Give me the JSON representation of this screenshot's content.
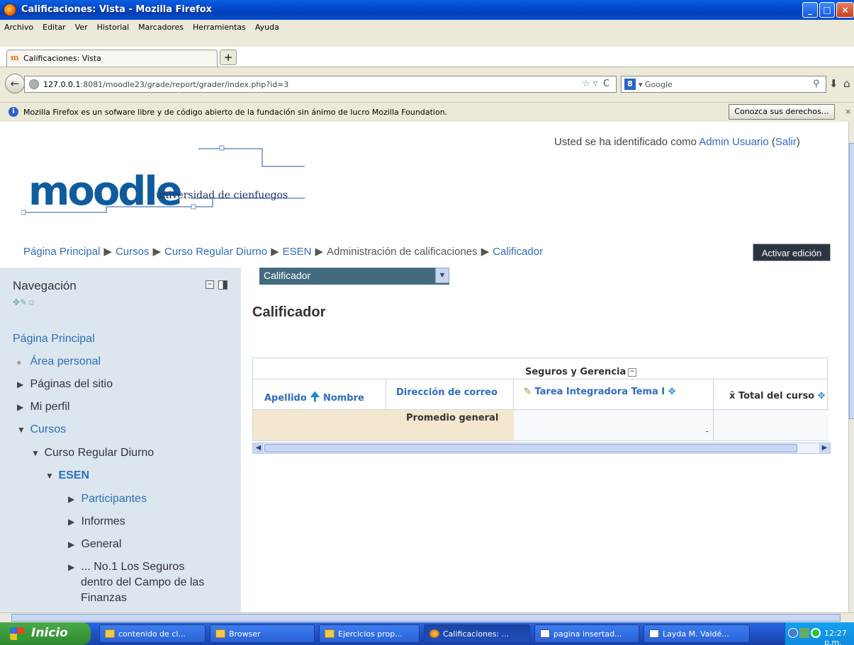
{
  "window": {
    "title": "Calificaciones: Vista - Mozilla Firefox"
  },
  "menu": [
    "Archivo",
    "Editar",
    "Ver",
    "Historial",
    "Marcadores",
    "Herramientas",
    "Ayuda"
  ],
  "tab": {
    "icon_text": "m",
    "label": "Calificaciones: Vista",
    "new_tab": "+"
  },
  "nav": {
    "url_host": "127.0.0.1",
    "url_rest": ":8081/moodle23/grade/report/grader/index.php?id=3",
    "search_placeholder": "Google",
    "search_engine_letter": "8"
  },
  "notification": {
    "text": "Mozilla Firefox es un sofware libre y de código abierto de la fundación sin ánimo de lucro Mozilla Foundation.",
    "button": "Conozca sus derechos…",
    "close": "×"
  },
  "page": {
    "login_prefix": "Usted se ha identificado como ",
    "login_user": "Admin Usuario",
    "logout": "Salir",
    "logo_word": "moodle",
    "logo_sub": "universidad de cienfuegos",
    "breadcrumb": [
      "Página Principal",
      "Cursos",
      "Curso Regular Diurno",
      "ESEN",
      "Administración de calificaciones",
      "Calificador"
    ],
    "edit_button": "Activar edición",
    "select_value": "Calificador",
    "main_title": "Calificador"
  },
  "sidebar": {
    "heading": "Navegación",
    "items": {
      "home": "Página Principal",
      "personal": "Área personal",
      "site_pages": "Páginas del sitio",
      "profile": "Mi perfil",
      "courses": "Cursos",
      "course": "Curso Regular Diurno",
      "esen": "ESEN",
      "participants": "Participantes",
      "reports": "Informes",
      "general": "General",
      "topic_1": "... No.1 Los Seguros",
      "topic_2": "dentro del Campo de las",
      "topic_3": "Finanzas"
    }
  },
  "grader": {
    "category": "Seguros y Gerencia",
    "col_surname": "Apellido",
    "col_name": "Nombre",
    "col_email": "Dirección de correo",
    "col_task": "Tarea Integradora Tema I",
    "col_total": "Total del curso",
    "avg_label": "Promedio general",
    "avg_value": "-"
  },
  "taskbar": {
    "start": "Inicio",
    "tasks": [
      "contenido de cl...",
      "Browser",
      "Ejercicios prop...",
      "Calificaciones: ...",
      "pagina insertad...",
      "Layda M. Valdé..."
    ],
    "clock": "12:27 p.m."
  }
}
